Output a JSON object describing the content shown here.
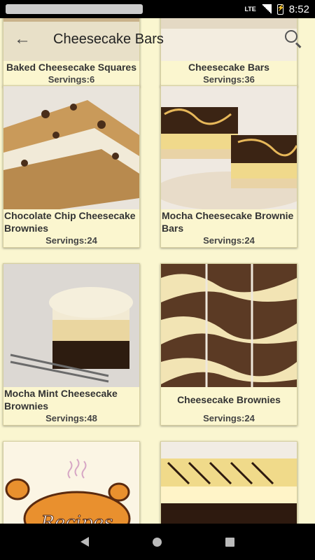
{
  "status": {
    "time": "8:52",
    "network": "LTE"
  },
  "toolbar": {
    "title": "Cheesecake Bars"
  },
  "recipes": [
    {
      "title": "Baked Cheesecake Squares",
      "servings": "Servings:6"
    },
    {
      "title": "Cheesecake Bars",
      "servings": "Servings:36"
    },
    {
      "title": "Chocolate Chip Cheesecake Brownies",
      "servings": "Servings:24"
    },
    {
      "title": "Mocha Cheesecake Brownie Bars",
      "servings": "Servings:24"
    },
    {
      "title": "Mocha Mint Cheesecake Brownies",
      "servings": "Servings:48"
    },
    {
      "title": "Cheesecake Brownies",
      "servings": "Servings:24"
    },
    {
      "title": "",
      "servings": ""
    },
    {
      "title": "",
      "servings": ""
    }
  ],
  "logo_text": "Recipes",
  "colors": {
    "background": "#faf6d0",
    "card": "#fbf6cf",
    "status_bar": "#000000"
  }
}
